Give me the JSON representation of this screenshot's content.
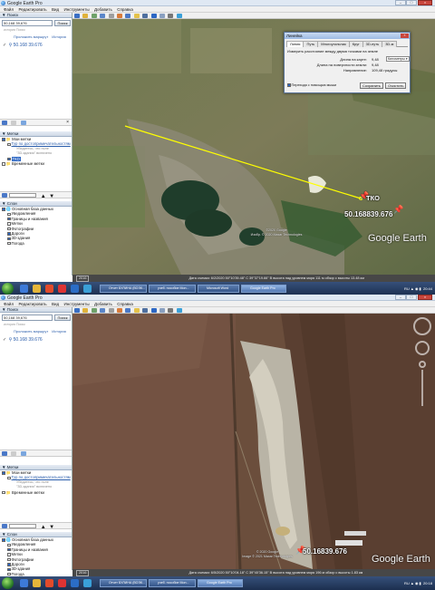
{
  "app": {
    "title": "Google Earth Pro",
    "menu": [
      "Файл",
      "Редактировать",
      "Вид",
      "Инструменты",
      "Добавить",
      "Справка"
    ]
  },
  "search": {
    "header": "▼ Поиск",
    "value": "50,168 39,676",
    "button": "Поиск",
    "history_link": "история Поиск",
    "route_label": "Проложить маршрут",
    "history_label": "История",
    "result": "50.168 39.676"
  },
  "places": {
    "header": "▼ Метки",
    "my_places": "Мои метки",
    "sightseeing": "Тур по достопримечательностям",
    "note1": "Убедитесь, что поле",
    "note2": "\"3D-здания\" включено",
    "tko": "ТКО",
    "temp": "Временные метки"
  },
  "layers": {
    "header": "▼ Слои",
    "items": [
      "Основная база данных",
      "Уведомления",
      "Границы и названия",
      "Метки",
      "Фотографии",
      "Дороги",
      "3D-здания",
      "Погода"
    ]
  },
  "dialog": {
    "title": "Линейка",
    "tabs": [
      "Линия",
      "Путь",
      "Многоугольник",
      "Круг",
      "3D-путь",
      "3D-м"
    ],
    "desc": "Измерить расстояние между двумя точками на земле",
    "rows": [
      {
        "k": "Длина на карте:",
        "v": "9,48"
      },
      {
        "k": "Длина на поверхности земли:",
        "v": "9,48"
      },
      {
        "k": "Направление:",
        "v": "109,48 градусы"
      }
    ],
    "unit": "Километры",
    "nav_mouse": "Перехода с помощью мыши",
    "save": "Сохранить",
    "clear": "Очистить"
  },
  "map1": {
    "pin_label": "ТКО",
    "coord_label": "50.168839.676",
    "copyright": "©2020 Google\nИзобр. © 2020 Maxar Technologies",
    "status": "Дата съемки: 6/2/2020   50°10'39.48\" С   39°37'19.66\" В   высота над уровнем моря   111 м   обзор с высоты 13.48 км",
    "year": "2016",
    "logo": "Google Earth"
  },
  "map2": {
    "coord_label": "50.16839.676",
    "copyright": "© 2020 Google\nImage © 2021 Maxar Technologies",
    "status": "Дата съемки: 6/5/2020   50°10'04.18\" С   39°40'36.15\" В   высота над уровнем моря   196 м   обзор с высоты 1.83 км",
    "year": "2016",
    "logo": "Google Earth"
  },
  "taskbar": {
    "windows1": [
      "Отчет БУЛИНА (ВОЭК...",
      "учеб. пособие Мон...",
      "Microsoft Word",
      "Google Earth Pro"
    ],
    "windows2": [
      "Отчет БУЛИНА (ВОЭК...",
      "учеб. пособие Мон...",
      "Google Earth Pro"
    ],
    "lang": "RU",
    "time": "20:44",
    "time2": "20:18"
  }
}
